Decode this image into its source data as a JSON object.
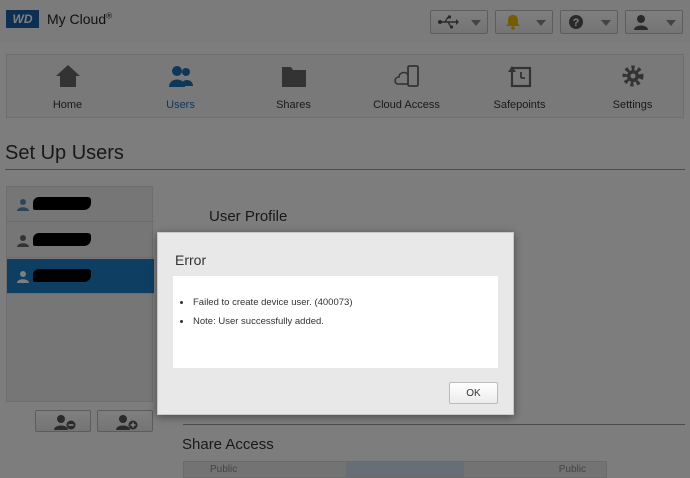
{
  "app": {
    "logo_text": "WD",
    "title": "My Cloud",
    "trademark": "®"
  },
  "top_buttons": [
    {
      "icon": "usb-icon"
    },
    {
      "icon": "bell-icon",
      "accent": "#e8b800"
    },
    {
      "icon": "help-icon"
    },
    {
      "icon": "user-icon"
    }
  ],
  "nav": {
    "items": [
      {
        "label": "Home",
        "icon": "home-icon",
        "active": false
      },
      {
        "label": "Users",
        "icon": "users-icon",
        "active": true
      },
      {
        "label": "Shares",
        "icon": "folder-icon",
        "active": false
      },
      {
        "label": "Cloud Access",
        "icon": "cloud-device-icon",
        "active": false
      },
      {
        "label": "Safepoints",
        "icon": "safepoint-icon",
        "active": false
      },
      {
        "label": "Settings",
        "icon": "gear-icon",
        "active": false
      }
    ]
  },
  "page": {
    "title": "Set Up Users"
  },
  "users": {
    "rows": [
      {
        "selected": false
      },
      {
        "selected": false
      },
      {
        "selected": true
      }
    ]
  },
  "user_profile": {
    "heading": "User Profile"
  },
  "share_access": {
    "heading": "Share Access",
    "row_left": "Public",
    "row_right": "Public"
  },
  "dialog": {
    "title": "Error",
    "messages": [
      "Failed to create device user. (400073)",
      "Note: User successfully added."
    ],
    "ok_label": "OK"
  },
  "colors": {
    "accent": "#1e6fb5",
    "selected_row": "#1c7fc4",
    "brand": "#1b5ea8"
  }
}
